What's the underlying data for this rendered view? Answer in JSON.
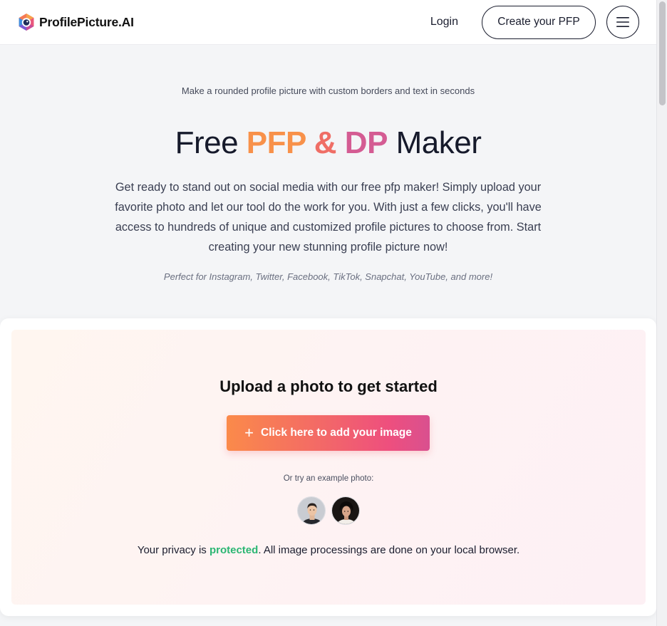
{
  "header": {
    "logo_text": "ProfilePicture.AI",
    "login_label": "Login",
    "cta_label": "Create your PFP",
    "menu_icon": "hamburger-icon"
  },
  "hero": {
    "tagline": "Make a rounded profile picture with custom borders and text in seconds",
    "title_prefix": "Free ",
    "title_pfp": "PFP",
    "title_amp": " & ",
    "title_dp": "DP",
    "title_suffix": " Maker",
    "lead": "Get ready to stand out on social media with our free pfp maker! Simply upload your favorite photo and let our tool do the work for you. With just a few clicks, you'll have access to hundreds of unique and customized profile pictures to choose from. Start creating your new stunning profile picture now!",
    "platforms": "Perfect for Instagram, Twitter, Facebook, TikTok, Snapchat, YouTube, and more!"
  },
  "upload": {
    "title": "Upload a photo to get started",
    "button_label": "Click here to add your image",
    "example_label": "Or try an example photo:",
    "privacy_prefix": "Your privacy is ",
    "privacy_highlight": "protected",
    "privacy_suffix": ". All image processings are done on your local browser."
  },
  "colors": {
    "accent_orange": "#f8914a",
    "accent_coral": "#ef6e66",
    "accent_pink": "#d45c93",
    "privacy_green": "#2bb673",
    "text_dark": "#161a2b"
  }
}
